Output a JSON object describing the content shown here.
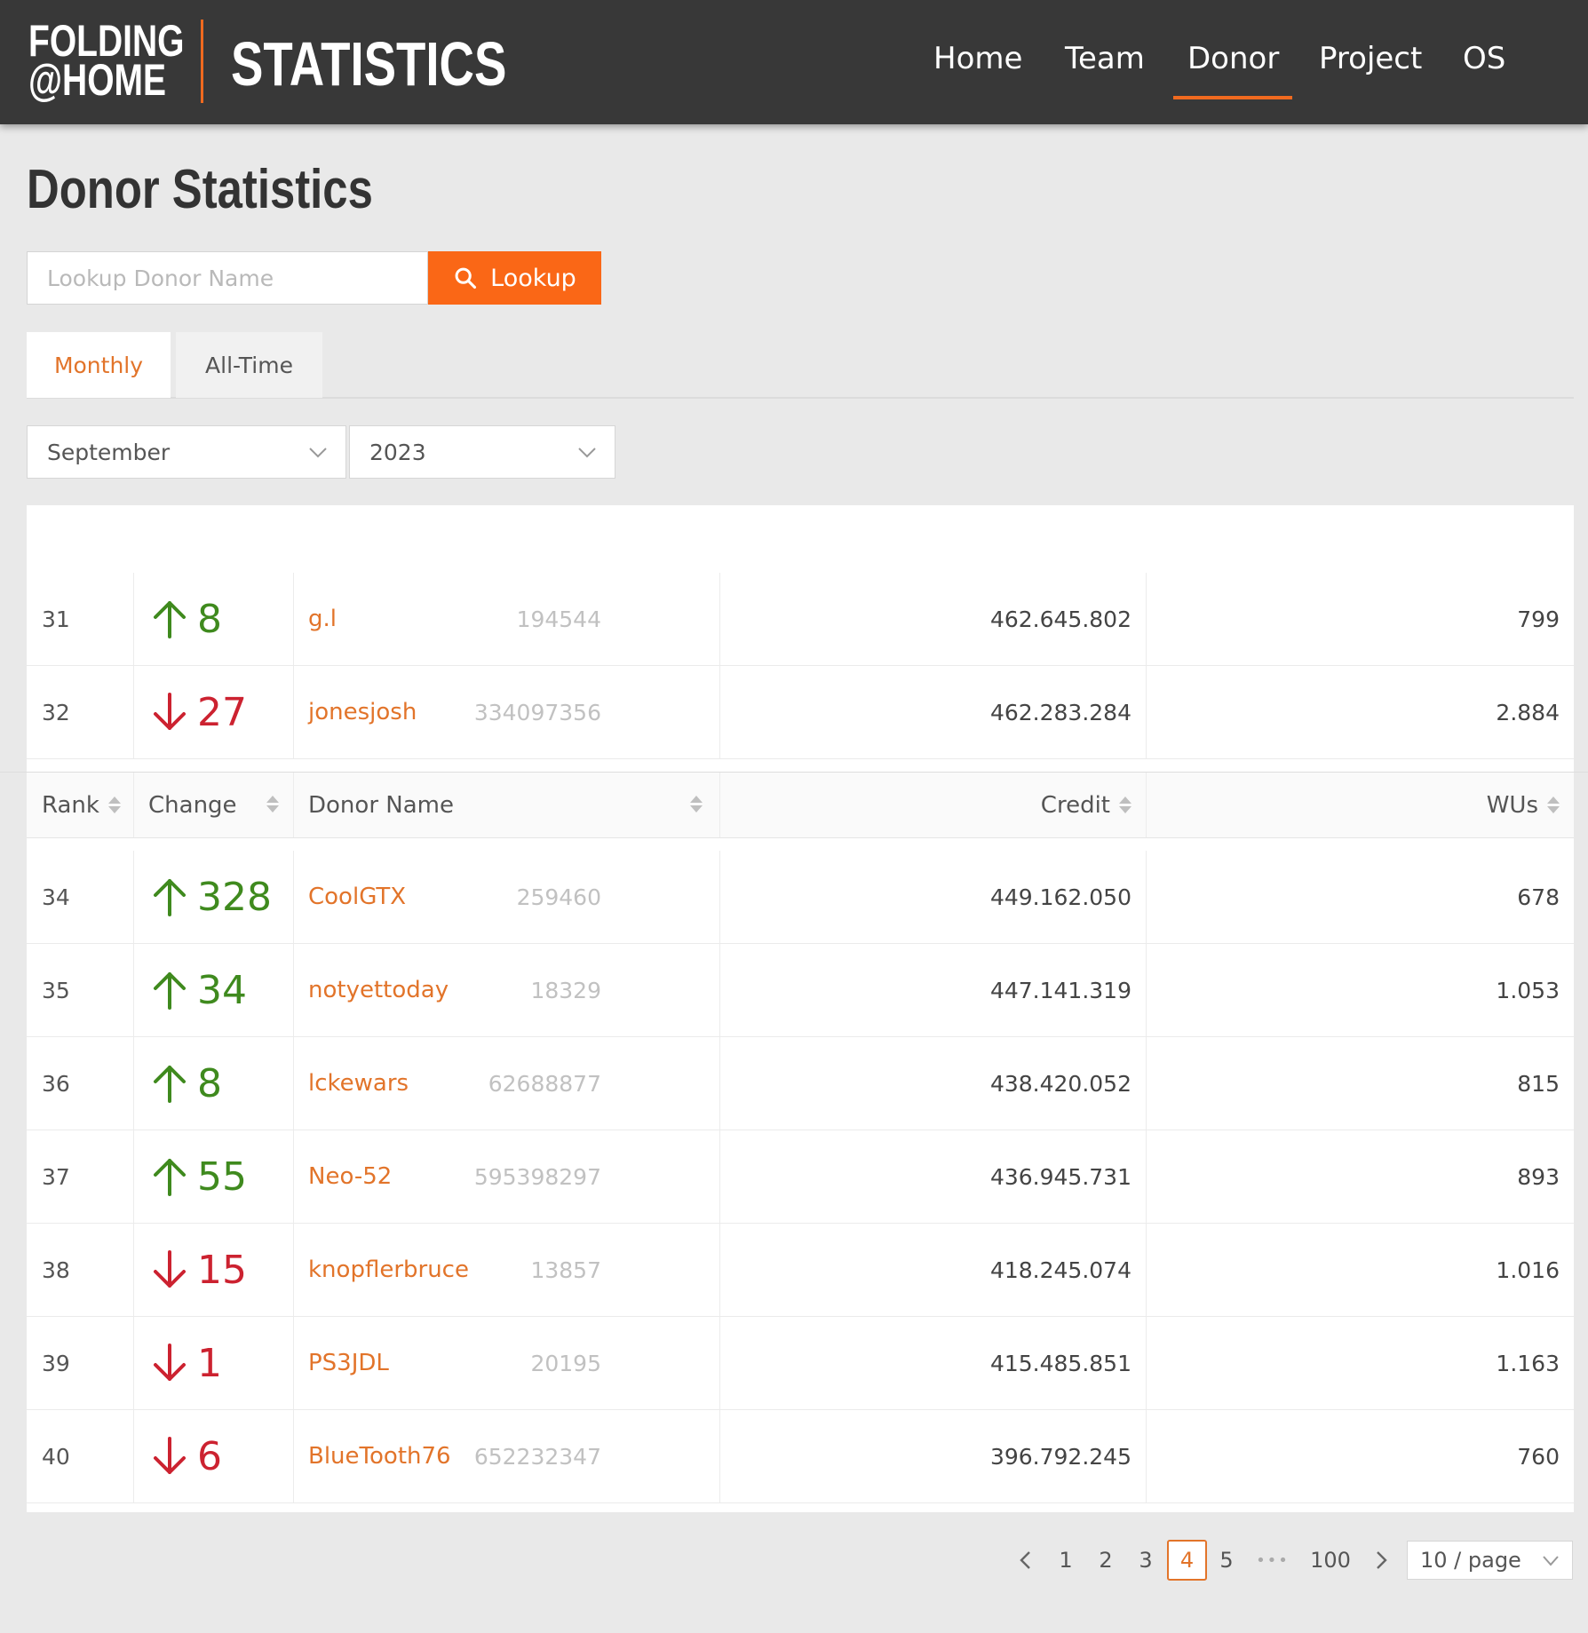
{
  "header": {
    "logo_line1": "FOLDING",
    "logo_line2": "@HOME",
    "title": "STATISTICS",
    "nav": [
      "Home",
      "Team",
      "Donor",
      "Project",
      "OS"
    ],
    "active_nav": "Donor",
    "accent_color": "#f06a1f"
  },
  "page": {
    "title": "Donor Statistics",
    "search_placeholder": "Lookup Donor Name",
    "lookup_label": "Lookup",
    "tabs": [
      "Monthly",
      "All-Time"
    ],
    "active_tab": "Monthly",
    "month": "September",
    "year": "2023"
  },
  "table": {
    "columns": [
      "Rank",
      "Change",
      "Donor Name",
      "Credit",
      "WUs"
    ],
    "rows_above": [
      {
        "rank": "31",
        "dir": "up",
        "change": "8",
        "name": "g.l",
        "id": "194544",
        "credit": "462.645.802",
        "wus": "799"
      },
      {
        "rank": "32",
        "dir": "down",
        "change": "27",
        "name": "jonesjosh",
        "id": "334097356",
        "credit": "462.283.284",
        "wus": "2.884"
      }
    ],
    "rows_below": [
      {
        "rank": "34",
        "dir": "up",
        "change": "328",
        "name": "CoolGTX",
        "id": "259460",
        "credit": "449.162.050",
        "wus": "678"
      },
      {
        "rank": "35",
        "dir": "up",
        "change": "34",
        "name": "notyettoday",
        "id": "18329",
        "credit": "447.141.319",
        "wus": "1.053"
      },
      {
        "rank": "36",
        "dir": "up",
        "change": "8",
        "name": "lckewars",
        "id": "62688877",
        "credit": "438.420.052",
        "wus": "815"
      },
      {
        "rank": "37",
        "dir": "up",
        "change": "55",
        "name": "Neo-52",
        "id": "595398297",
        "credit": "436.945.731",
        "wus": "893"
      },
      {
        "rank": "38",
        "dir": "down",
        "change": "15",
        "name": "knopflerbruce",
        "id": "13857",
        "credit": "418.245.074",
        "wus": "1.016"
      },
      {
        "rank": "39",
        "dir": "down",
        "change": "1",
        "name": "PS3JDL",
        "id": "20195",
        "credit": "415.485.851",
        "wus": "1.163"
      },
      {
        "rank": "40",
        "dir": "down",
        "change": "6",
        "name": "BlueTooth76",
        "id": "652232347",
        "credit": "396.792.245",
        "wus": "760"
      }
    ],
    "up_color": "#3f8a1e",
    "down_color": "#cc2230"
  },
  "pagination": {
    "prev_icon": "chevron-left-icon",
    "pages": [
      "1",
      "2",
      "3",
      "4",
      "5"
    ],
    "current": "4",
    "ellipsis": "•••",
    "last": "100",
    "next_icon": "chevron-right-icon",
    "page_size": "10 / page"
  }
}
